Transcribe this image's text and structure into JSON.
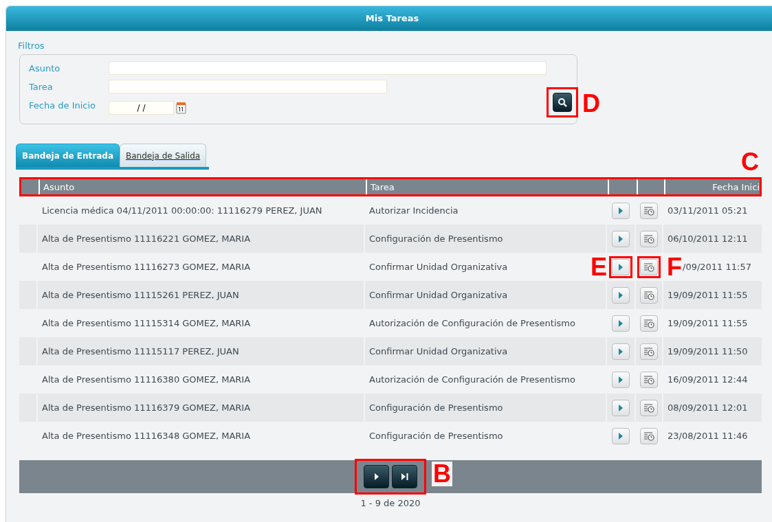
{
  "window": {
    "title": "Mis Tareas"
  },
  "filters": {
    "title": "Filtros",
    "fields": [
      {
        "label": "Asunto",
        "kind": "text"
      },
      {
        "label": "Tarea",
        "kind": "text"
      },
      {
        "label": "Fecha de Inicio",
        "kind": "date",
        "value": "/ /"
      }
    ],
    "search_annotation": "D"
  },
  "tabs": [
    {
      "label": "Bandeja de Entrada",
      "selected": true
    },
    {
      "label": "Bandeja de Salida",
      "selected": false
    }
  ],
  "table": {
    "annotation": "C",
    "columns": [
      "Asunto",
      "Tarea",
      "Fecha Inici"
    ],
    "rows": [
      {
        "asunto": "Licencia médica 04/11/2011 00:00:00: 11116279 PEREZ, JUAN",
        "tarea": "Autorizar Incidencia",
        "fecha": "03/11/2011 05:21"
      },
      {
        "asunto": "Alta de Presentismo 11116221 GOMEZ, MARIA",
        "tarea": "Configuración de Presentismo",
        "fecha": "06/10/2011 12:11"
      },
      {
        "asunto": "Alta de Presentismo 11116273 GOMEZ, MARIA",
        "tarea": "Confirmar Unidad Organizativa",
        "fecha": "/09/2011 11:57",
        "play_annotation": "E",
        "detail_annotation": "F"
      },
      {
        "asunto": "Alta de Presentismo 11115261 PEREZ, JUAN",
        "tarea": "Confirmar Unidad Organizativa",
        "fecha": "19/09/2011 11:55"
      },
      {
        "asunto": "Alta de Presentismo 11115314 GOMEZ, MARIA",
        "tarea": "Autorización de Configuración de Presentismo",
        "fecha": "19/09/2011 11:55"
      },
      {
        "asunto": "Alta de Presentismo 11115117 PEREZ, JUAN",
        "tarea": "Confirmar Unidad Organizativa",
        "fecha": "19/09/2011 11:50"
      },
      {
        "asunto": "Alta de Presentismo 11116380 GOMEZ, MARIA",
        "tarea": "Autorización de Configuración de Presentismo",
        "fecha": "16/09/2011 12:44"
      },
      {
        "asunto": "Alta de Presentismo 11116379 GOMEZ, MARIA",
        "tarea": "Configuración de Presentismo",
        "fecha": "08/09/2011 12:01"
      },
      {
        "asunto": "Alta de Presentismo 11116348 GOMEZ, MARIA",
        "tarea": "Configuración de Presentismo",
        "fecha": "23/08/2011 11:46"
      }
    ]
  },
  "pager": {
    "annotation": "B",
    "summary": "1 - 9 de 2020"
  }
}
